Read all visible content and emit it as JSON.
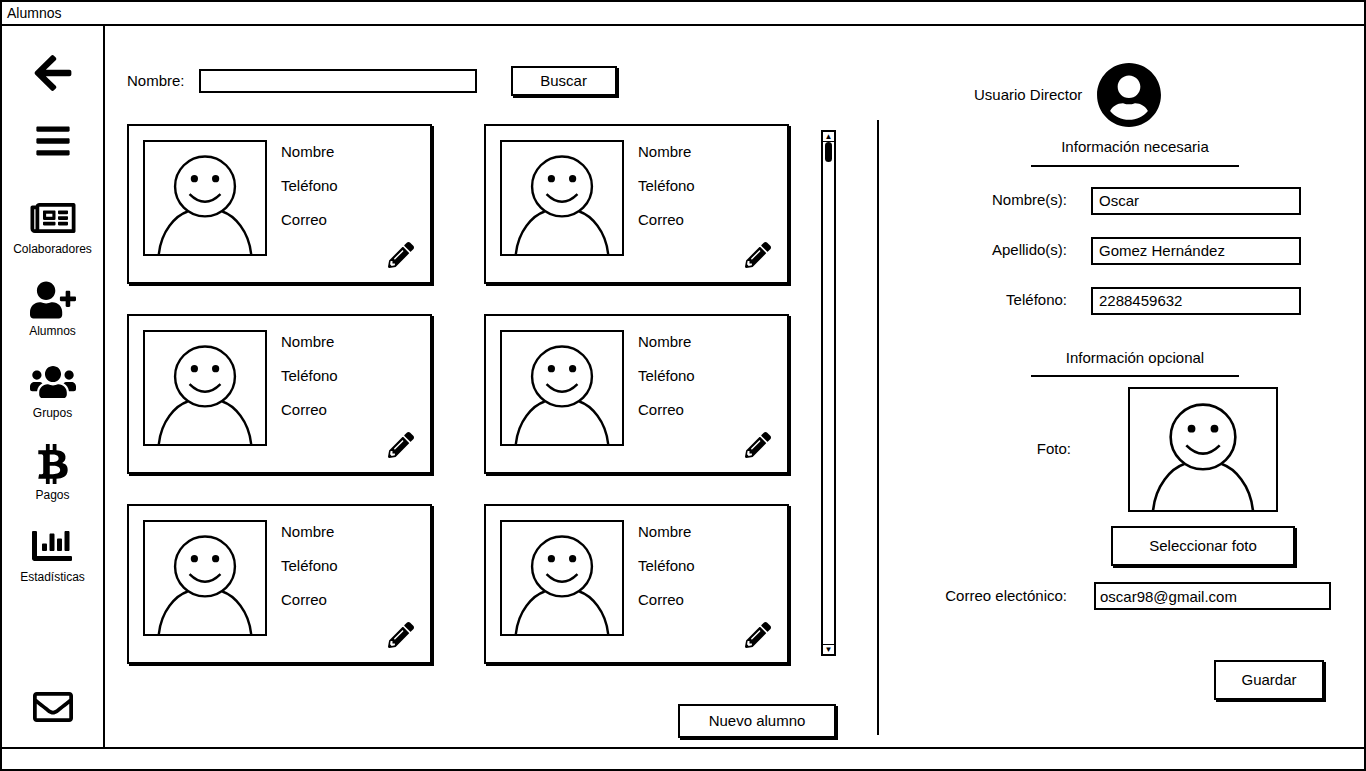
{
  "window": {
    "title": "Alumnos"
  },
  "sidebar": {
    "items": [
      {
        "label": "Colaboradores"
      },
      {
        "label": "Alumnos"
      },
      {
        "label": "Grupos"
      },
      {
        "label": "Pagos"
      },
      {
        "label": "Estadísticas"
      }
    ]
  },
  "search": {
    "label": "Nombre:",
    "value": "",
    "button": "Buscar"
  },
  "students": [
    {
      "name": "Nombre",
      "phone": "Teléfono",
      "email": "Correo"
    },
    {
      "name": "Nombre",
      "phone": "Teléfono",
      "email": "Correo"
    },
    {
      "name": "Nombre",
      "phone": "Teléfono",
      "email": "Correo"
    },
    {
      "name": "Nombre",
      "phone": "Teléfono",
      "email": "Correo"
    },
    {
      "name": "Nombre",
      "phone": "Teléfono",
      "email": "Correo"
    },
    {
      "name": "Nombre",
      "phone": "Teléfono",
      "email": "Correo"
    }
  ],
  "scrollbar": {
    "level": 0
  },
  "new_button": "Nuevo alumno",
  "user": {
    "label": "Usuario Director"
  },
  "form": {
    "required_title": "Información necesaria",
    "fields": [
      {
        "label": "Nombre(s):",
        "value": "Oscar"
      },
      {
        "label": "Apellido(s):",
        "value": "Gomez Hernández"
      },
      {
        "label": "Teléfono:",
        "value": "2288459632"
      }
    ],
    "optional_title": "Información opcional",
    "photo_label": "Foto:",
    "photo_button": "Seleccionar foto",
    "email": {
      "label": "Correo electónico:",
      "value": "oscar98@gmail.com"
    },
    "save_button": "Guardar"
  }
}
